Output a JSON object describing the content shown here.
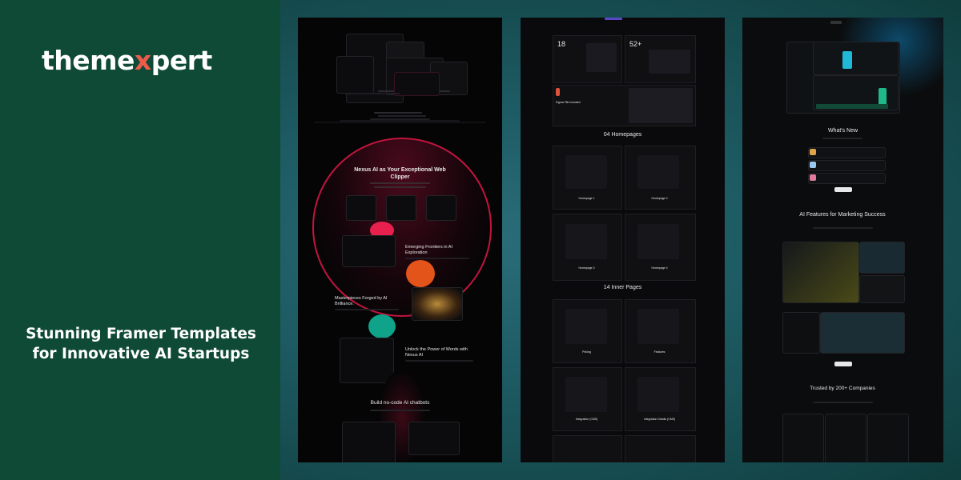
{
  "brand": {
    "name_pre": "theme",
    "name_x": "x",
    "name_post": "pert",
    "accent": "#ef5b4a"
  },
  "headline": "Stunning Framer Templates for Innovative AI Startups",
  "colors": {
    "left_panel": "#0f4a36",
    "right_bg": "#1f5d66"
  },
  "screens": {
    "one": {
      "hero_title": "Nexus AI as Your Exceptional Web Clipper",
      "feature_a": "Emerging Frontiers in AI Exploration",
      "feature_b": "Masterpieces Forged by AI Brilliance.",
      "feature_c": "Unlock the Power of Words with Nexus AI",
      "section": "Build no-code AI chatbots"
    },
    "two": {
      "stat_a": "18",
      "stat_b": "52+",
      "figma": "Figma File Included",
      "homepages": "04 Homepages",
      "inner": "14 Inner Pages",
      "hp_labels": [
        "Homepage 1",
        "Homepage 2",
        "Homepage 3",
        "Homepage 4"
      ],
      "ip_labels": [
        "Pricing",
        "Features",
        "Integration (CMS)",
        "Integration Details (CMS)"
      ]
    },
    "three": {
      "whats_new": "What's New",
      "features_title": "AI Features for Marketing Success",
      "trusted": "Trusted by 200+ Companies"
    }
  }
}
